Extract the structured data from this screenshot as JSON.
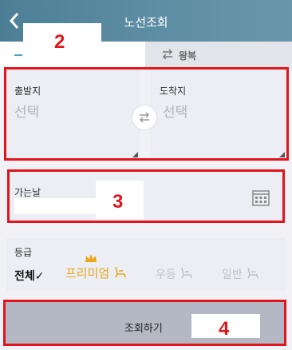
{
  "header": {
    "title": "노선조회"
  },
  "tabs": {
    "round_trip_label": "왕복"
  },
  "stations": {
    "departure_label": "출발지",
    "departure_value": "선택",
    "arrival_label": "도착지",
    "arrival_value": "선택"
  },
  "date": {
    "label": "가는날"
  },
  "grade": {
    "label": "등급",
    "options": [
      {
        "label": "전체✓",
        "selected": true
      },
      {
        "label": "프리미엄",
        "selected": false
      },
      {
        "label": "우등",
        "selected": false
      },
      {
        "label": "일반",
        "selected": false
      }
    ]
  },
  "submit": {
    "label": "조회하기"
  },
  "annotations": [
    "2",
    "3",
    "4"
  ],
  "colors": {
    "header": "#5a8ba0",
    "accent": "#4ca3c4",
    "premium": "#e9a71b",
    "annotation": "#e0161c"
  }
}
